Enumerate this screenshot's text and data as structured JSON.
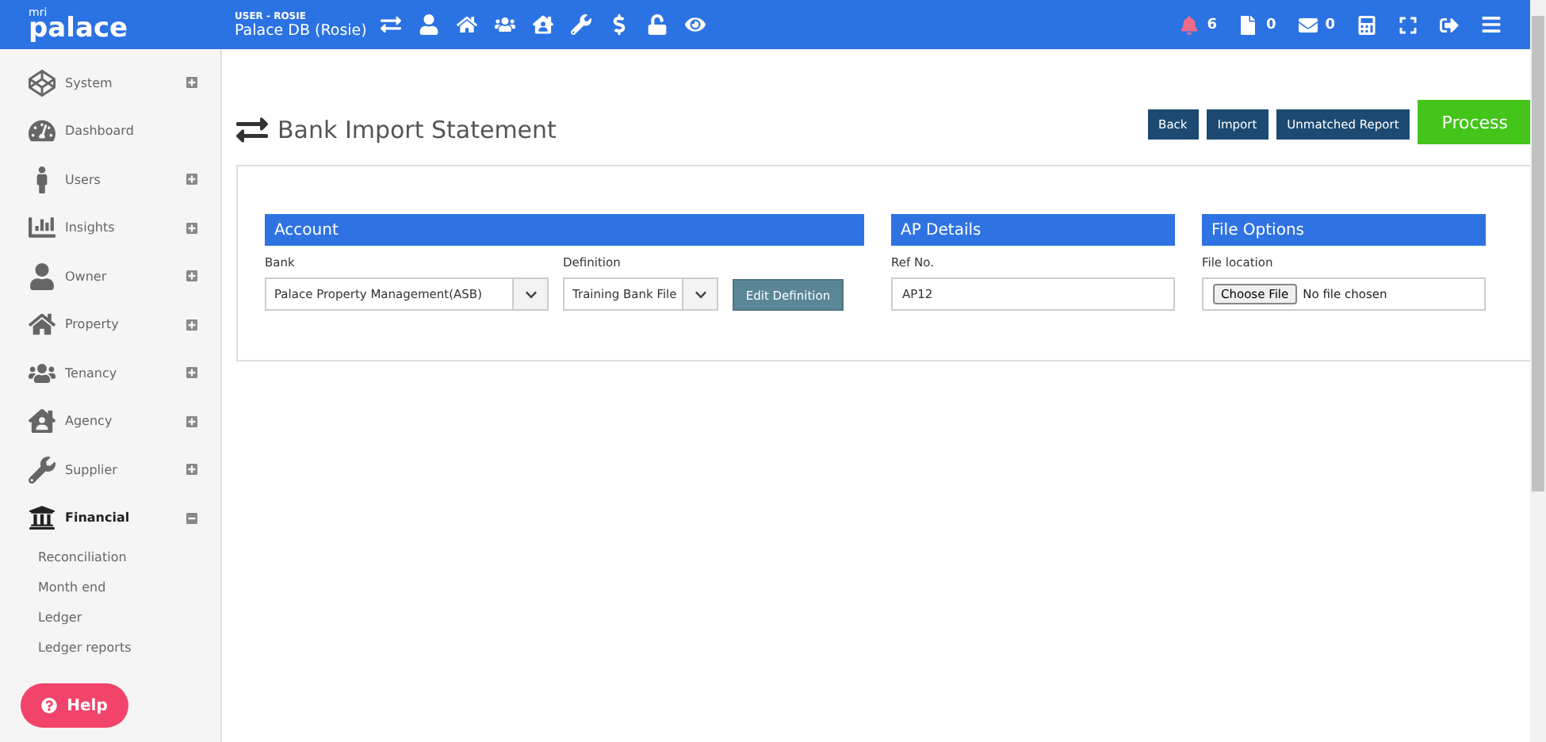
{
  "topbar": {
    "logo_small": "mri",
    "logo": "palace",
    "user_label": "USER - ROSIE",
    "database": "Palace DB (Rosie)",
    "counters": [
      {
        "count": "6",
        "alert": true
      },
      {
        "count": "0",
        "alert": false
      },
      {
        "count": "0",
        "alert": false
      }
    ]
  },
  "sidebar": {
    "items": [
      {
        "label": "System",
        "kind": "group",
        "expanded": false,
        "selected": false
      },
      {
        "label": "Dashboard",
        "kind": "link",
        "selected": false
      },
      {
        "label": "Users",
        "kind": "group",
        "expanded": false,
        "selected": false
      },
      {
        "label": "Insights",
        "kind": "group",
        "expanded": false,
        "selected": false
      },
      {
        "label": "Owner",
        "kind": "group",
        "expanded": false,
        "selected": false
      },
      {
        "label": "Property",
        "kind": "group",
        "expanded": false,
        "selected": false
      },
      {
        "label": "Tenancy",
        "kind": "group",
        "expanded": false,
        "selected": false
      },
      {
        "label": "Agency",
        "kind": "group",
        "expanded": false,
        "selected": false
      },
      {
        "label": "Supplier",
        "kind": "group",
        "expanded": false,
        "selected": false
      },
      {
        "label": "Financial",
        "kind": "group",
        "expanded": true,
        "selected": true,
        "children": [
          {
            "label": "Reconciliation"
          },
          {
            "label": "Month end"
          },
          {
            "label": "Ledger"
          },
          {
            "label": "Ledger reports"
          }
        ]
      }
    ]
  },
  "help_button": "Help",
  "page": {
    "title": "Bank Import Statement",
    "actions": [
      {
        "label": "Back",
        "kind": "secondary"
      },
      {
        "label": "Import",
        "kind": "secondary"
      },
      {
        "label": "Unmatched Report",
        "kind": "secondary"
      },
      {
        "label": "Process",
        "kind": "primary"
      }
    ]
  },
  "account": {
    "heading": "Account",
    "bank_label": "Bank",
    "bank_value": "Palace Property Management(ASB)",
    "definition_label": "Definition",
    "definition_value": "Training Bank File",
    "edit_button": "Edit Definition"
  },
  "ap_details": {
    "heading": "AP Details",
    "ref_label": "Ref No.",
    "ref_value": "AP12"
  },
  "file_options": {
    "heading": "File Options",
    "location_label": "File location",
    "choose_button": "Choose File",
    "file_status": "No file chosen"
  }
}
